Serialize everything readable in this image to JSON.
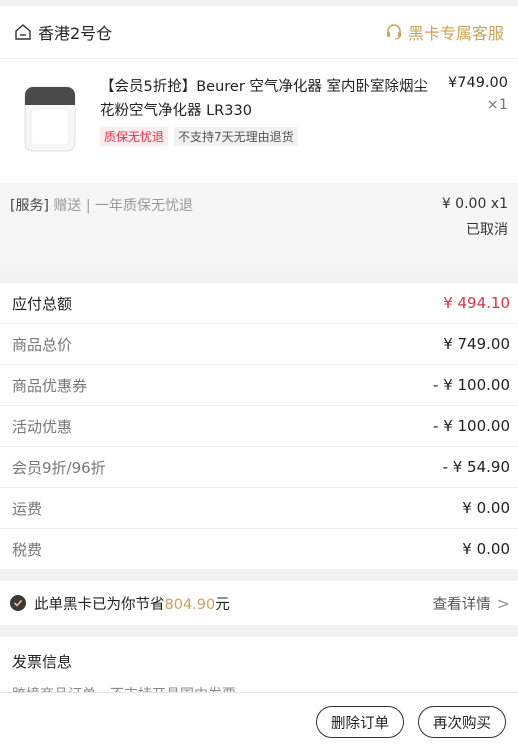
{
  "store": {
    "name": "香港2号仓",
    "service_label": "黑卡专属客服"
  },
  "product": {
    "title": "【会员5折抢】Beurer 空气净化器 室内卧室除烟尘花粉空气净化器 LR330",
    "price": "¥749.00",
    "qty": "×1",
    "tags": [
      "质保无忧退",
      "不支持7天无理由退货"
    ]
  },
  "service": {
    "prefix": "[服务]",
    "gift": "赠送",
    "desc": " | 一年质保无忧退",
    "price": "¥ 0.00 x1",
    "status": "已取消"
  },
  "summary": [
    {
      "label": "应付总额",
      "value": "¥ 494.10"
    },
    {
      "label": "商品总价",
      "value": "¥ 749.00"
    },
    {
      "label": "商品优惠券",
      "value": "- ¥ 100.00"
    },
    {
      "label": "活动优惠",
      "value": "- ¥ 100.00"
    },
    {
      "label": "会员9折/96折",
      "value": "- ¥ 54.90"
    },
    {
      "label": "运费",
      "value": "¥ 0.00"
    },
    {
      "label": "税费",
      "value": "¥ 0.00"
    }
  ],
  "savings": {
    "prefix": "此单黑卡已为你节省",
    "amount": "804.90",
    "suffix": "元",
    "detail": "查看详情"
  },
  "invoice": {
    "title": "发票信息",
    "desc": "跨境商品订单，不支持开具国内发票"
  },
  "actions": {
    "delete": "删除订单",
    "rebuy": "再次购买"
  },
  "colors": {
    "accent_red": "#d6354a",
    "gold": "#c9a35a"
  }
}
